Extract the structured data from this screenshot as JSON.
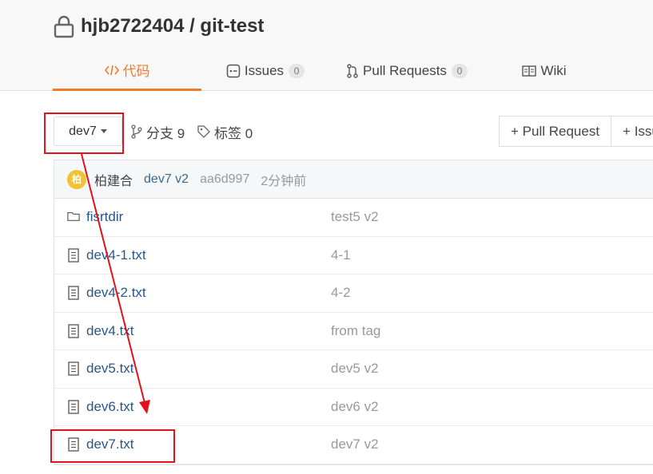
{
  "repo": {
    "title": "hjb2722404 / git-test",
    "icon": "lock-icon"
  },
  "tabs": [
    {
      "label": "代码",
      "icon": "code-icon",
      "active": true
    },
    {
      "label": "Issues",
      "icon": "issues-icon",
      "count": "0"
    },
    {
      "label": "Pull Requests",
      "icon": "pull-request-icon",
      "count": "0"
    },
    {
      "label": "Wiki",
      "icon": "book-icon"
    }
  ],
  "toolbar": {
    "branch": "dev7",
    "branches_label": "分支 9",
    "tags_label": "标签 0",
    "pull_request_button": "+ Pull Request",
    "issue_button": "+ Issu"
  },
  "last_commit": {
    "avatar_text": "柏",
    "author": "柏建合",
    "message": "dev7 v2",
    "sha": "aa6d997",
    "time": "2分钟前"
  },
  "files": [
    {
      "name": "fisrtdir",
      "type": "folder",
      "commit": "test5 v2"
    },
    {
      "name": "dev4-1.txt",
      "type": "file",
      "commit": "4-1"
    },
    {
      "name": "dev4-2.txt",
      "type": "file",
      "commit": "4-2"
    },
    {
      "name": "dev4.txt",
      "type": "file",
      "commit": "from tag"
    },
    {
      "name": "dev5.txt",
      "type": "file",
      "commit": "dev5 v2"
    },
    {
      "name": "dev6.txt",
      "type": "file",
      "commit": "dev6 v2"
    },
    {
      "name": "dev7.txt",
      "type": "file",
      "commit": "dev7 v2"
    }
  ],
  "colors": {
    "accent": "#f07a2c",
    "link": "#27568a",
    "annotation": "#e0121b"
  }
}
